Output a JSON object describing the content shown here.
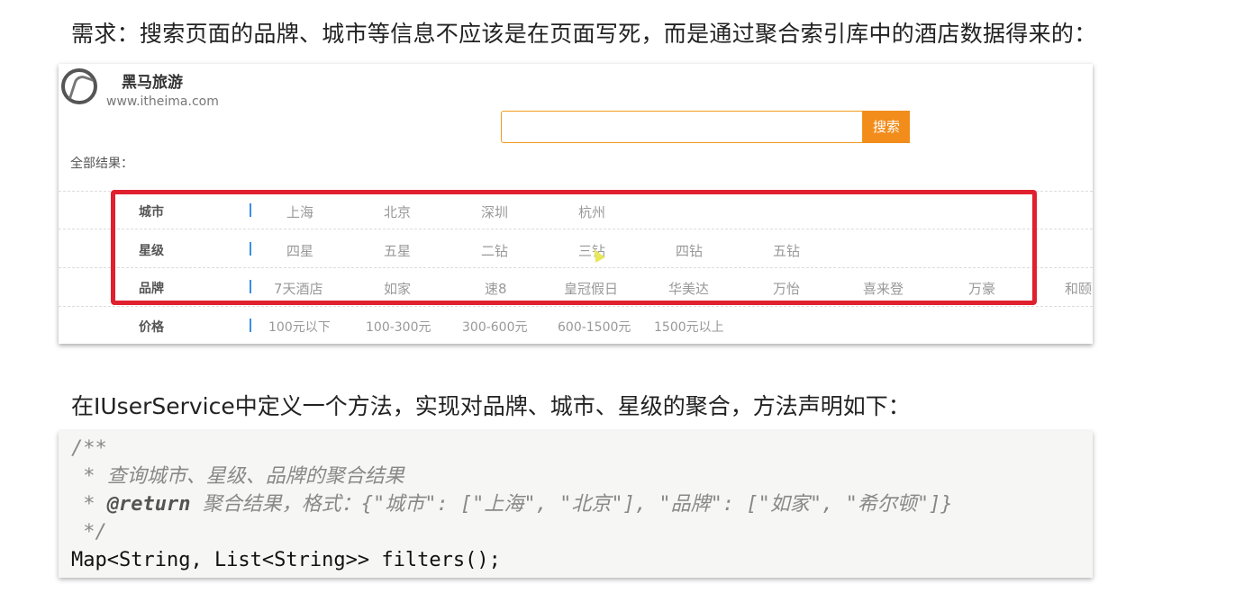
{
  "intro_text": "需求：搜索页面的品牌、城市等信息不应该是在页面写死，而是通过聚合索引库中的酒店数据得来的：",
  "screenshot": {
    "brand_name": "黑马旅游",
    "brand_url": "www.itheima.com",
    "search_button": "搜索",
    "all_results_label": "全部结果：",
    "filters": [
      {
        "label": "城市",
        "options": [
          "上海",
          "北京",
          "深圳",
          "杭州"
        ]
      },
      {
        "label": "星级",
        "options": [
          "四星",
          "五星",
          "二钻",
          "三钻",
          "四钻",
          "五钻"
        ]
      },
      {
        "label": "品牌",
        "options": [
          "7天酒店",
          "如家",
          "速8",
          "皇冠假日",
          "华美达",
          "万怡",
          "喜来登",
          "万豪",
          "和颐"
        ]
      },
      {
        "label": "价格",
        "options": [
          "100元以下",
          "100-300元",
          "300-600元",
          "600-1500元",
          "1500元以上"
        ]
      }
    ]
  },
  "method_intro": "在IUserService中定义一个方法，实现对品牌、城市、星级的聚合，方法声明如下：",
  "code": {
    "line1": "/**",
    "line2": " * 查询城市、星级、品牌的聚合结果",
    "line3_prefix": " * ",
    "line3_tag": "@return",
    "line3_rest": " 聚合结果，格式：{\"城市\": [\"上海\", \"北京\"], \"品牌\": [\"如家\", \"希尔顿\"]}",
    "line4": " */",
    "line5": "Map<String, List<String>> filters();"
  },
  "colors": {
    "accent_orange": "#f28c1b",
    "highlight_red": "#e0202e",
    "divider_blue": "#3a8ee6"
  }
}
